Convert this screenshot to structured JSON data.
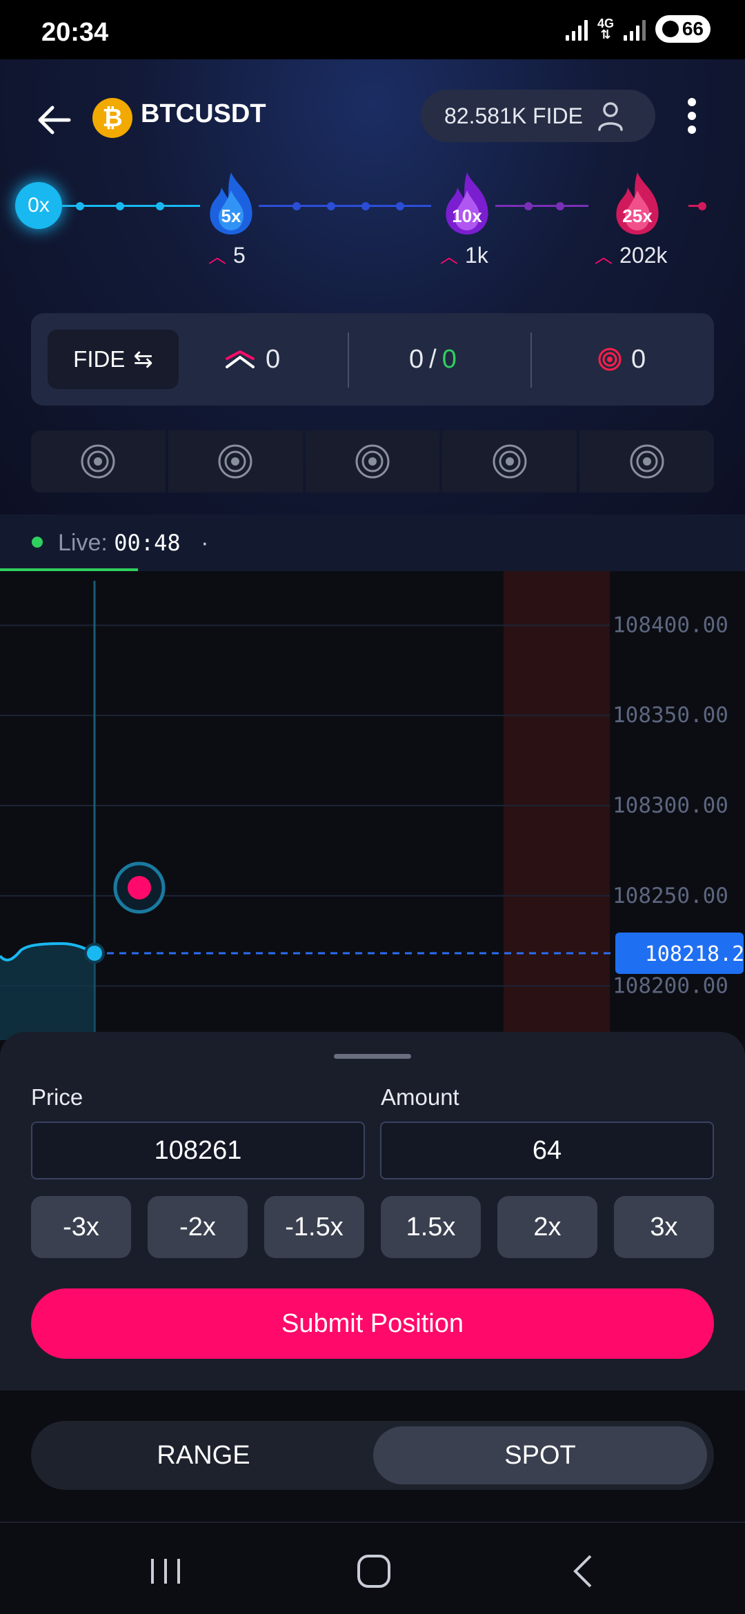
{
  "status_bar": {
    "time": "20:34",
    "network": "4G",
    "battery": "66"
  },
  "header": {
    "pair": "BTCUSDT",
    "coin_symbol": "₿",
    "balance": "82.581K FIDE"
  },
  "tiers": [
    {
      "label": "0x"
    },
    {
      "label": "5x",
      "count": "5"
    },
    {
      "label": "10x",
      "count": "1k"
    },
    {
      "label": "25x",
      "count": "202k"
    }
  ],
  "stats": {
    "currency": "FIDE",
    "positions": "0",
    "ratio_left": "0",
    "ratio_sep": "/",
    "ratio_right": "0",
    "targets": "0"
  },
  "live": {
    "label": "Live:",
    "time": "00:48",
    "marker": "·"
  },
  "chart_data": {
    "type": "line",
    "y_ticks": [
      "108400.00",
      "108350.00",
      "108300.00",
      "108250.00",
      "108200.00"
    ],
    "current_price": "108218.20",
    "ylim": [
      108170,
      108430
    ]
  },
  "order": {
    "price_label": "Price",
    "price_value": "108261",
    "amount_label": "Amount",
    "amount_value": "64",
    "multipliers": [
      "-3x",
      "-2x",
      "-1.5x",
      "1.5x",
      "2x",
      "3x"
    ],
    "submit_label": "Submit Position"
  },
  "mode": {
    "range_label": "RANGE",
    "spot_label": "SPOT",
    "active": "SPOT"
  },
  "colors": {
    "accent_pink": "#ff0a6a",
    "live_green": "#2fd15e",
    "price_tag": "#1f6ff2",
    "cyan": "#19b8f0"
  }
}
